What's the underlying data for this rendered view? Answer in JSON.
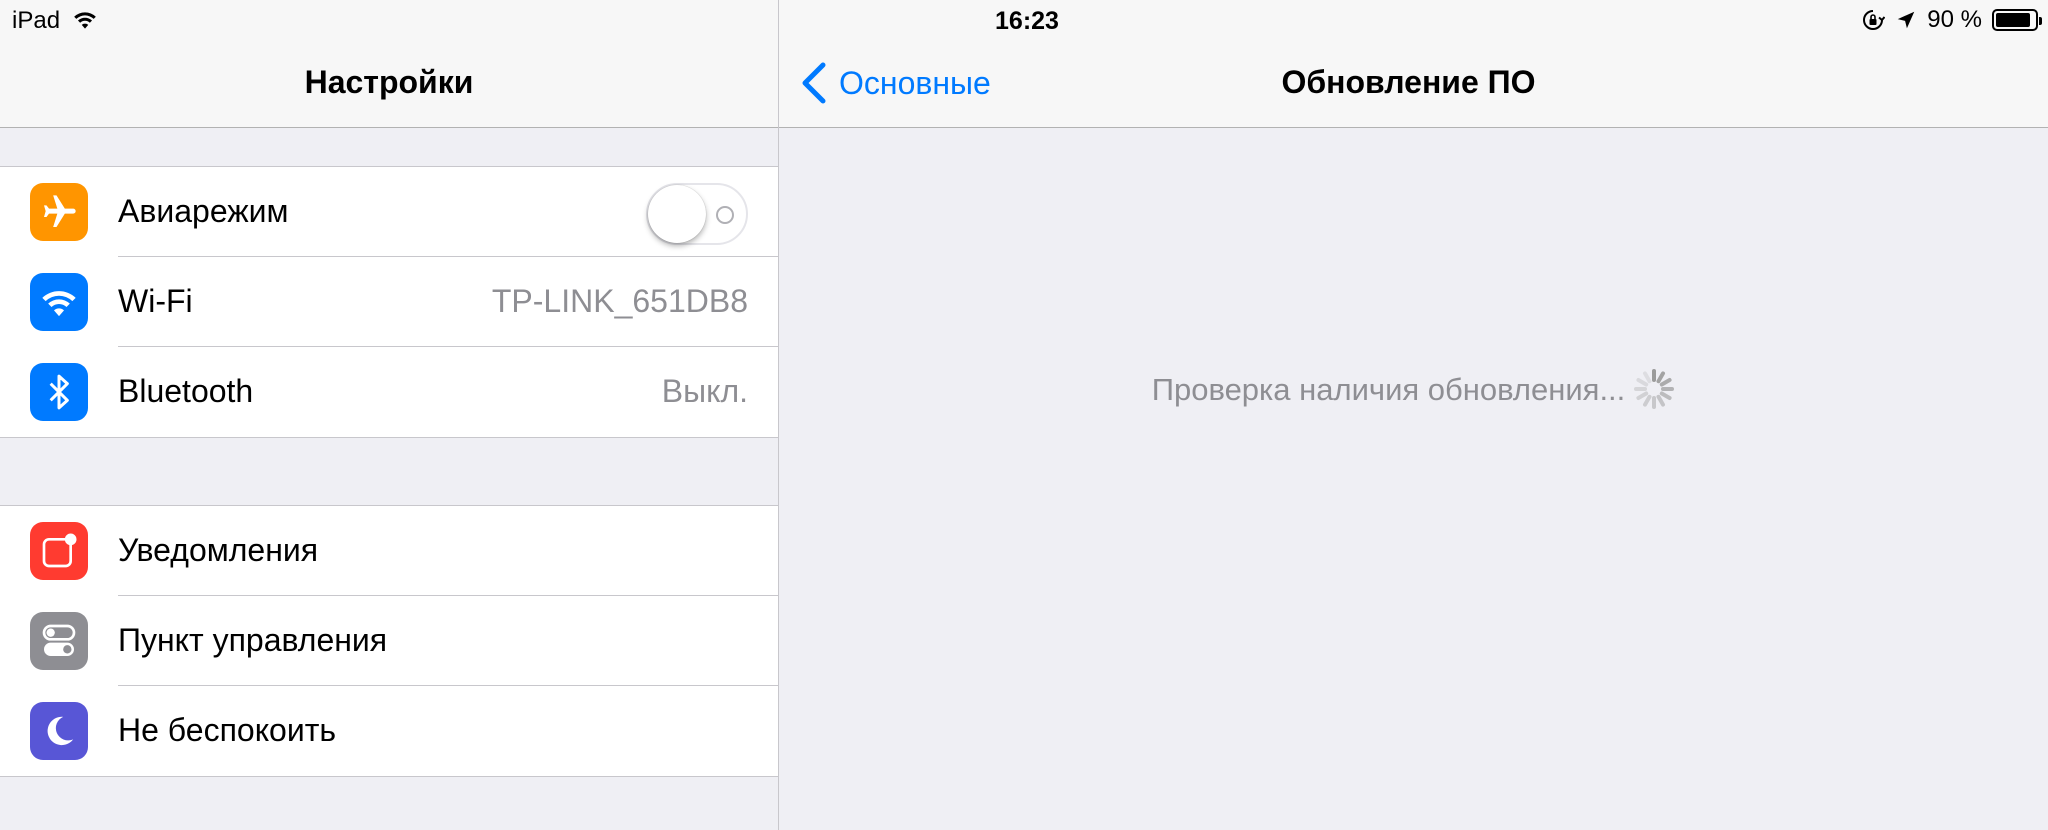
{
  "status": {
    "device": "iPad",
    "time": "16:23",
    "battery": "90 %",
    "battery_level": 0.9
  },
  "left": {
    "title": "Настройки",
    "group1": [
      {
        "label": "Авиарежим",
        "icon": "airplane-icon",
        "color": "#ff9500",
        "toggle": false
      },
      {
        "label": "Wi-Fi",
        "icon": "wifi-icon",
        "color": "#007aff",
        "value": "TP-LINK_651DB8"
      },
      {
        "label": "Bluetooth",
        "icon": "bluetooth-icon",
        "color": "#007aff",
        "value": "Выкл."
      }
    ],
    "group2": [
      {
        "label": "Уведомления",
        "icon": "notifications-icon",
        "color": "#ff3b30"
      },
      {
        "label": "Пункт управления",
        "icon": "control-center-icon",
        "color": "#8e8e93"
      },
      {
        "label": "Не беспокоить",
        "icon": "moon-icon",
        "color": "#5856d6"
      }
    ]
  },
  "right": {
    "back_label": "Основные",
    "title": "Обновление ПО",
    "checking_text": "Проверка наличия обновления..."
  }
}
